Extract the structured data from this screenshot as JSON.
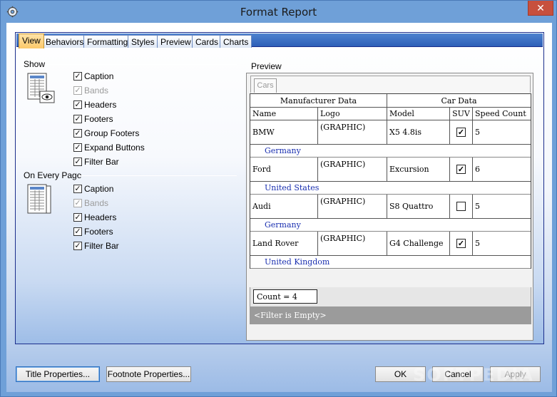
{
  "window": {
    "title": "Format Report",
    "close_glyph": "✕"
  },
  "tabs": [
    "View",
    "Behaviors",
    "Formatting",
    "Styles",
    "Preview",
    "Cards",
    "Charts"
  ],
  "active_tab": "View",
  "show": {
    "label": "Show",
    "items": [
      {
        "label": "Caption",
        "checked": true,
        "enabled": true
      },
      {
        "label": "Bands",
        "checked": true,
        "enabled": false
      },
      {
        "label": "Headers",
        "checked": true,
        "enabled": true
      },
      {
        "label": "Footers",
        "checked": true,
        "enabled": true
      },
      {
        "label": "Group Footers",
        "checked": true,
        "enabled": true
      },
      {
        "label": "Expand Buttons",
        "checked": true,
        "enabled": true
      },
      {
        "label": "Filter Bar",
        "checked": true,
        "enabled": true
      }
    ]
  },
  "every_page": {
    "label": "On Every Page",
    "items": [
      {
        "label": "Caption",
        "checked": true,
        "enabled": true
      },
      {
        "label": "Bands",
        "checked": true,
        "enabled": false
      },
      {
        "label": "Headers",
        "checked": true,
        "enabled": true
      },
      {
        "label": "Footers",
        "checked": true,
        "enabled": true
      },
      {
        "label": "Filter Bar",
        "checked": true,
        "enabled": true
      }
    ]
  },
  "preview": {
    "label": "Preview",
    "tab": "Cars",
    "bands": {
      "manufacturer": "Manufacturer Data",
      "car": "Car Data"
    },
    "columns": [
      "Name",
      "Logo",
      "Model",
      "SUV",
      "Speed Count"
    ],
    "rows": [
      {
        "name": "BMW",
        "logo": "(GRAPHIC)",
        "model": "X5 4.8is",
        "suv": true,
        "speed": "5",
        "group": "Germany"
      },
      {
        "name": "Ford",
        "logo": "(GRAPHIC)",
        "model": "Excursion",
        "suv": true,
        "speed": "6",
        "group": "United States"
      },
      {
        "name": "Audi",
        "logo": "(GRAPHIC)",
        "model": "S8 Quattro",
        "suv": false,
        "speed": "5",
        "group": "Germany"
      },
      {
        "name": "Land Rover",
        "logo": "(GRAPHIC)",
        "model": "G4 Challenge",
        "suv": true,
        "speed": "5",
        "group": "United Kingdom"
      }
    ],
    "count": "Count = 4",
    "filter": "<Filter is Empty>"
  },
  "buttons": {
    "title_properties": "Title Properties...",
    "footnote_properties": "Footnote Properties...",
    "ok": "OK",
    "cancel": "Cancel",
    "apply": "Apply"
  },
  "watermark": "SOFTPEDIA",
  "colors": {
    "frame_blue": "#6fa0d8",
    "active_tab": "#fbc96a",
    "band_text": "#1a2fb0"
  }
}
